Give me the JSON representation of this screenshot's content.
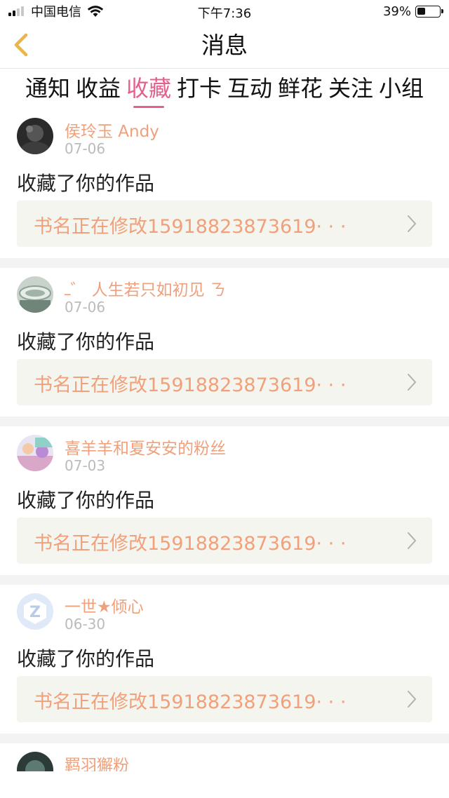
{
  "status_bar": {
    "carrier": "中国电信",
    "time": "下午7:36",
    "battery": "39%",
    "battery_level": 0.39,
    "icons": [
      "signal-icon",
      "wifi-icon",
      "battery-icon"
    ]
  },
  "nav": {
    "title": "消息",
    "back_icon": "chevron-left-icon"
  },
  "tabs": [
    {
      "label": "通知",
      "active": false
    },
    {
      "label": "收益",
      "active": false
    },
    {
      "label": "收藏",
      "active": true
    },
    {
      "label": "打卡",
      "active": false
    },
    {
      "label": "互动",
      "active": false
    },
    {
      "label": "鲜花",
      "active": false
    },
    {
      "label": "关注",
      "active": false
    },
    {
      "label": "小组",
      "active": false
    }
  ],
  "items": [
    {
      "user": "侯玲玉 Andy",
      "date": "07-06",
      "action": "收藏了你的作品",
      "work": "书名正在修改15918823873619· · ·"
    },
    {
      "user": "ߺ゛ 人生若只如初见 ㄋ",
      "date": "07-06",
      "action": "收藏了你的作品",
      "work": "书名正在修改15918823873619· · ·"
    },
    {
      "user": "喜羊羊和夏安安的粉丝",
      "date": "07-03",
      "action": "收藏了你的作品",
      "work": "书名正在修改15918823873619· · ·"
    },
    {
      "user": "一世★倾心",
      "date": "06-30",
      "action": "收藏了你的作品",
      "work": "书名正在修改15918823873619· · ·"
    },
    {
      "user": "羁羽獬粉",
      "date": "",
      "action": "",
      "work": ""
    }
  ],
  "colors": {
    "accent": "#e5608e",
    "username": "#f0a07a",
    "date": "#bbbbbb",
    "work_bg": "#f5f5ef",
    "back_arrow": "#e8b64a"
  }
}
